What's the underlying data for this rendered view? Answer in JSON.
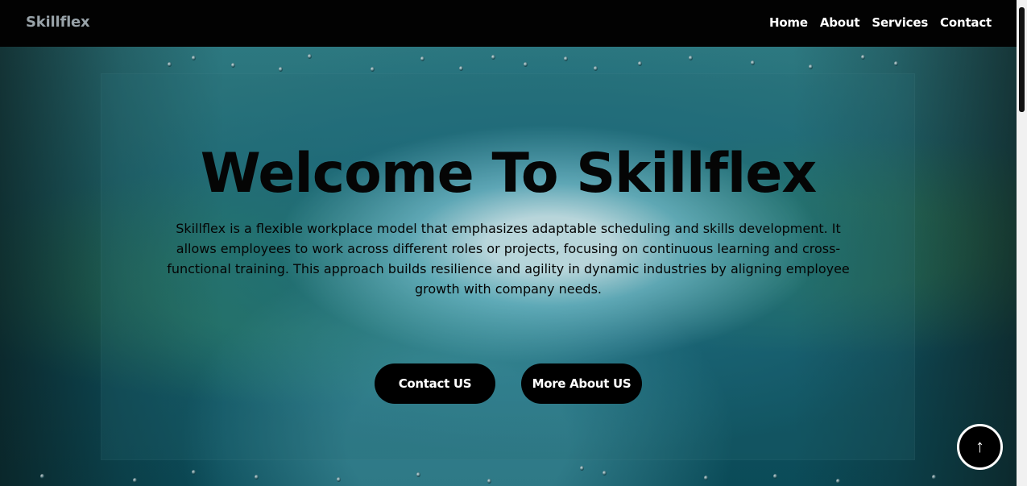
{
  "brand": {
    "name": "Skillflex"
  },
  "navigation": {
    "items": [
      {
        "label": "Home"
      },
      {
        "label": "About"
      },
      {
        "label": "Services"
      },
      {
        "label": "Contact"
      }
    ]
  },
  "hero": {
    "title": "Welcome To Skillflex",
    "description": "Skillflex is a flexible workplace model that emphasizes adaptable scheduling and skills development. It allows employees to work across different roles or projects, focusing on continuous learning and cross-functional training. This approach builds resilience and agility in dynamic industries by aligning employee growth with company needs.",
    "buttons": {
      "contact": "Contact US",
      "more_about": "More About US"
    }
  },
  "controls": {
    "scroll_top_icon": "arrow-up-icon"
  },
  "colors": {
    "navbar": "#020202",
    "logo": "#98a2a8",
    "button": "#000000",
    "button_text": "#ffffff",
    "title": "#050505"
  }
}
